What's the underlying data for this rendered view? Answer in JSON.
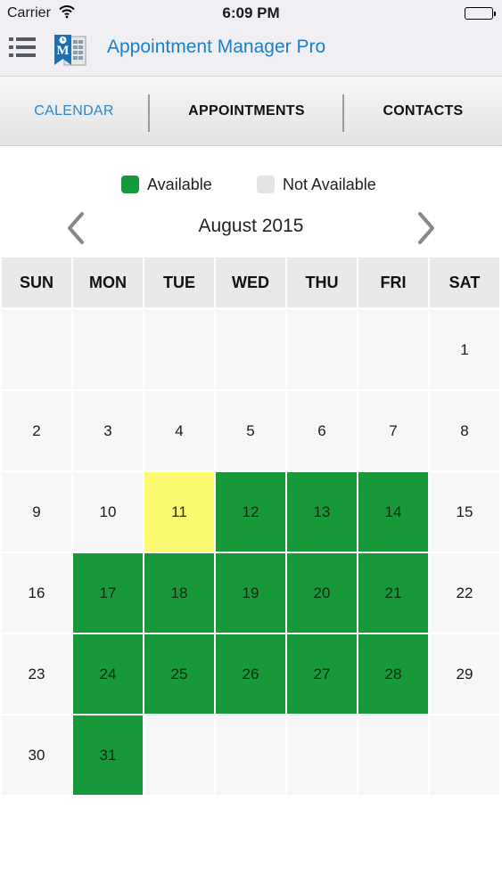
{
  "status_bar": {
    "carrier": "Carrier",
    "time": "6:09 PM"
  },
  "app": {
    "title": "Appointment Manager Pro",
    "logo_letter": "M",
    "icons": {
      "menu": "hamburger-menu-icon",
      "logo": "app-logo-icon"
    }
  },
  "tabs": [
    {
      "label": "CALENDAR",
      "active": true
    },
    {
      "label": "APPOINTMENTS",
      "active": false
    },
    {
      "label": "CONTACTS",
      "active": false
    }
  ],
  "legend": {
    "available": {
      "label": "Available",
      "color": "#17993b"
    },
    "not_available": {
      "label": "Not Available",
      "color": "#e4e4e6"
    }
  },
  "calendar": {
    "month_label": "August 2015",
    "weekdays": [
      "SUN",
      "MON",
      "TUE",
      "WED",
      "THU",
      "FRI",
      "SAT"
    ],
    "colors": {
      "available": "#17993b",
      "today": "#fbfa70",
      "default": "#f7f7f7",
      "header": "#e9e9eb"
    },
    "weeks": [
      [
        null,
        null,
        null,
        null,
        null,
        null,
        {
          "day": "1",
          "status": "default"
        }
      ],
      [
        {
          "day": "2",
          "status": "default"
        },
        {
          "day": "3",
          "status": "default"
        },
        {
          "day": "4",
          "status": "default"
        },
        {
          "day": "5",
          "status": "default"
        },
        {
          "day": "6",
          "status": "default"
        },
        {
          "day": "7",
          "status": "default"
        },
        {
          "day": "8",
          "status": "default"
        }
      ],
      [
        {
          "day": "9",
          "status": "default"
        },
        {
          "day": "10",
          "status": "default"
        },
        {
          "day": "11",
          "status": "today"
        },
        {
          "day": "12",
          "status": "available"
        },
        {
          "day": "13",
          "status": "available"
        },
        {
          "day": "14",
          "status": "available"
        },
        {
          "day": "15",
          "status": "default"
        }
      ],
      [
        {
          "day": "16",
          "status": "default"
        },
        {
          "day": "17",
          "status": "available"
        },
        {
          "day": "18",
          "status": "available"
        },
        {
          "day": "19",
          "status": "available"
        },
        {
          "day": "20",
          "status": "available"
        },
        {
          "day": "21",
          "status": "available"
        },
        {
          "day": "22",
          "status": "default"
        }
      ],
      [
        {
          "day": "23",
          "status": "default"
        },
        {
          "day": "24",
          "status": "available"
        },
        {
          "day": "25",
          "status": "available"
        },
        {
          "day": "26",
          "status": "available"
        },
        {
          "day": "27",
          "status": "available"
        },
        {
          "day": "28",
          "status": "available"
        },
        {
          "day": "29",
          "status": "default"
        }
      ],
      [
        {
          "day": "30",
          "status": "default"
        },
        {
          "day": "31",
          "status": "available"
        },
        null,
        null,
        null,
        null,
        null
      ]
    ]
  }
}
